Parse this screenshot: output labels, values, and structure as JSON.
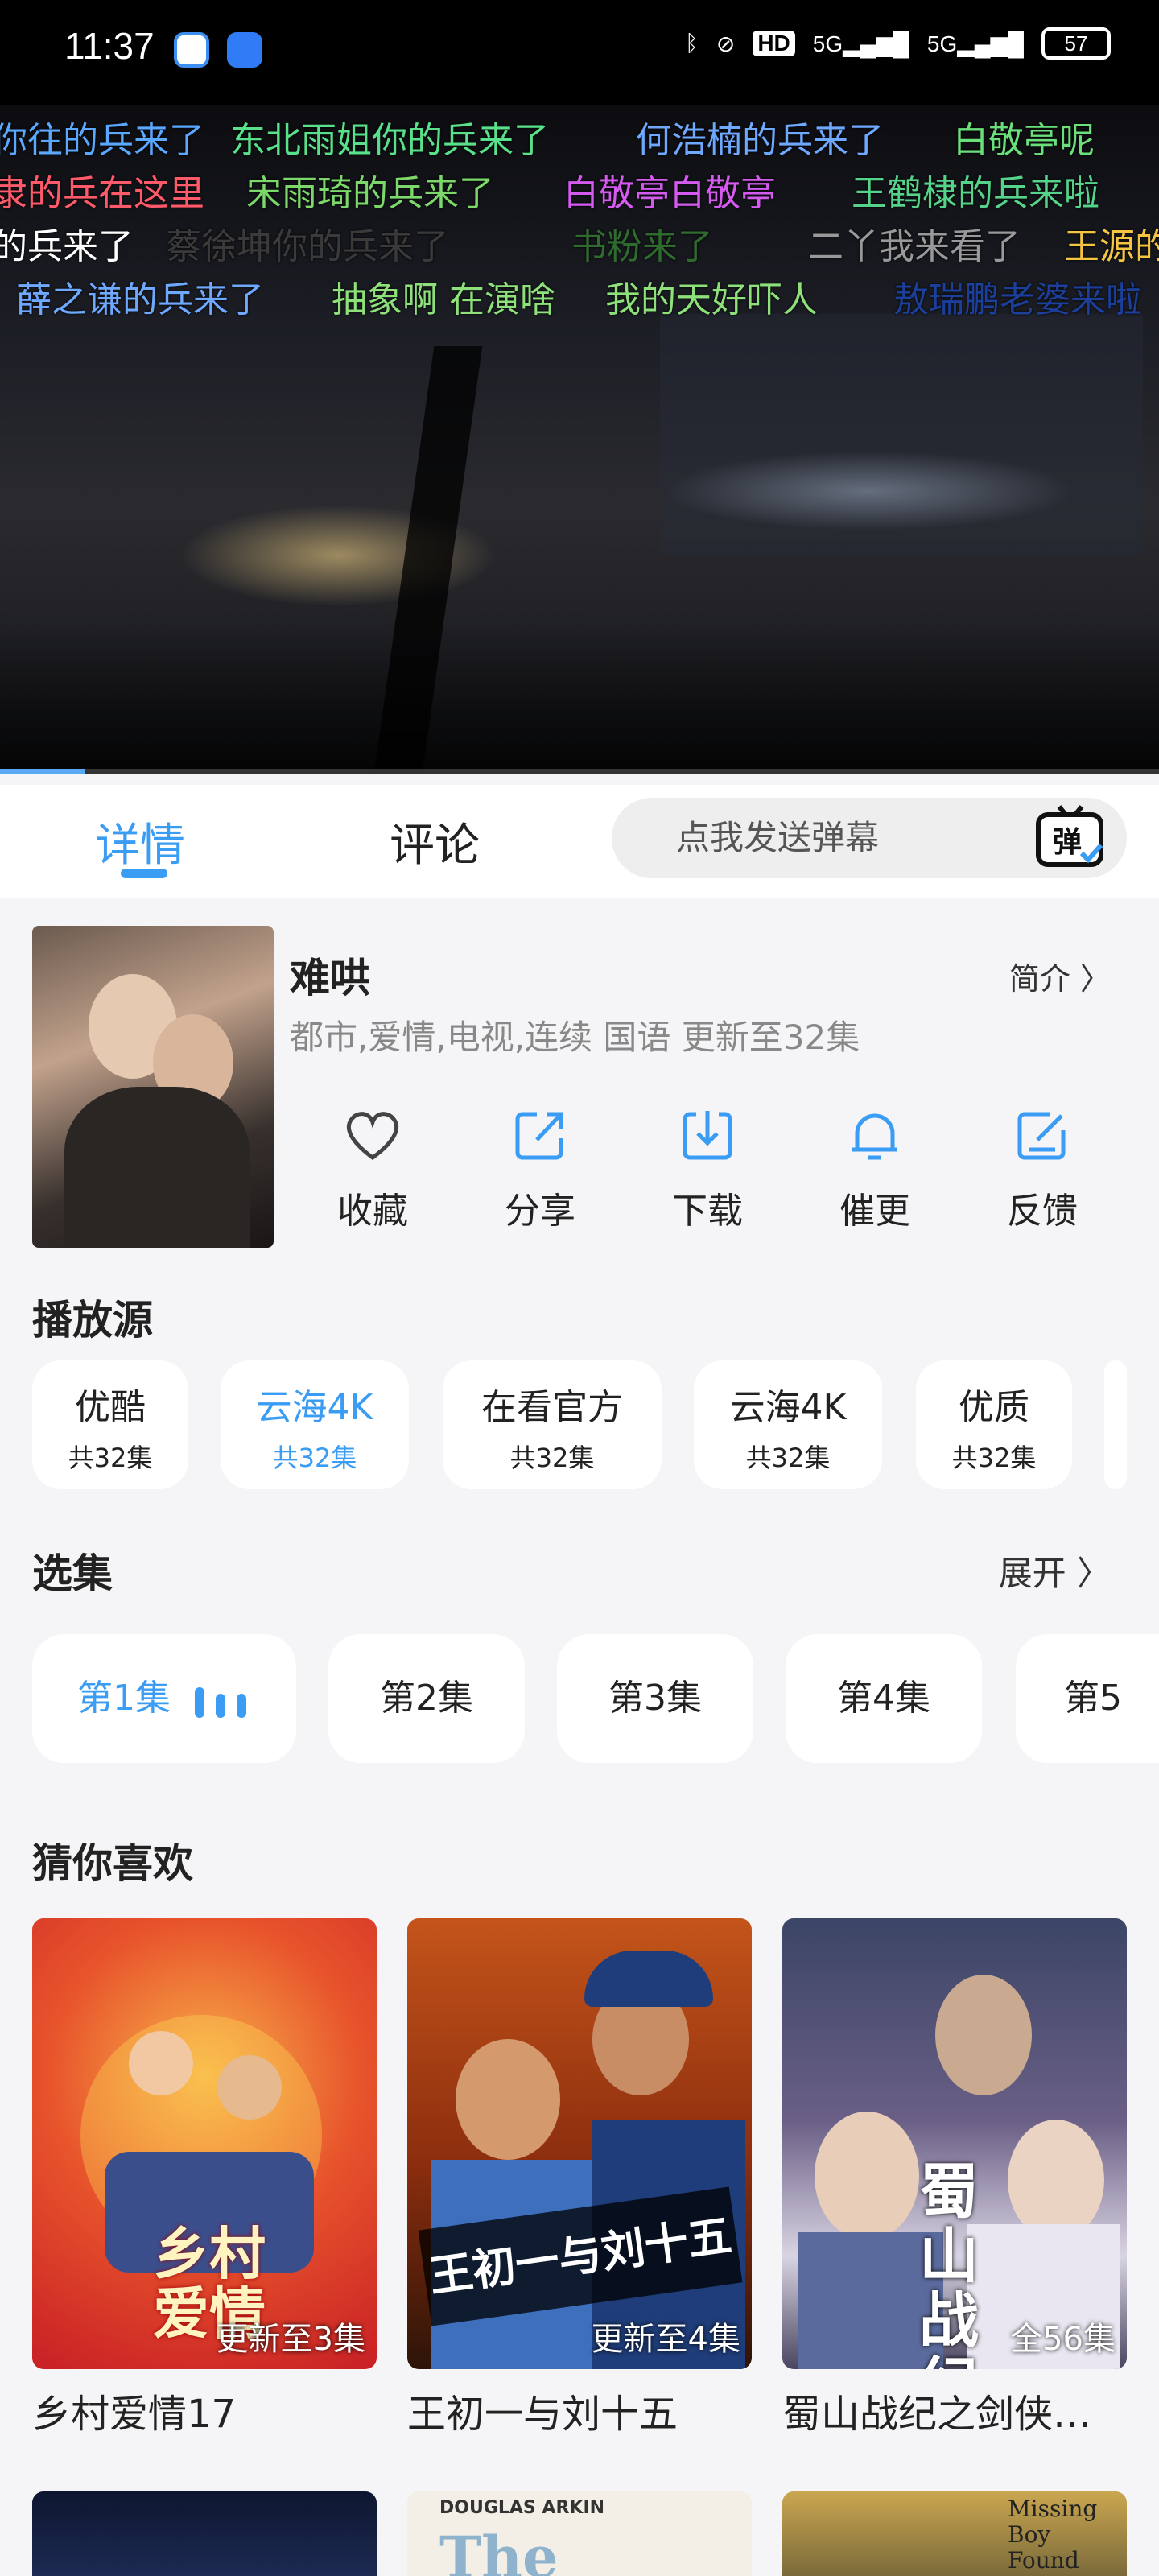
{
  "status_bar": {
    "time": "11:37",
    "battery": "57",
    "network": [
      "HD",
      "5G",
      "5G"
    ]
  },
  "danmaku": [
    {
      "text": "你往的兵来了",
      "color": "#5aa8ff"
    },
    {
      "text": "东北雨姐你的兵来了",
      "color": "#58e08a"
    },
    {
      "text": "何浩楠的兵来了",
      "color": "#6fa8ff"
    },
    {
      "text": "白敬亭呢",
      "color": "#6ae07a"
    },
    {
      "text": "隶的兵在这里",
      "color": "#ff5a6a"
    },
    {
      "text": "宋雨琦的兵来了",
      "color": "#7cd86a"
    },
    {
      "text": "白敬亭白敬亭",
      "color": "#d45af0"
    },
    {
      "text": "王鹤棣的兵来啦",
      "color": "#56d38a"
    },
    {
      "text": "的兵来了",
      "color": "#ffffff"
    },
    {
      "text": "蔡徐坤你的兵来了",
      "color": "#3a3a3a"
    },
    {
      "text": "书粉来了",
      "color": "#2f6a2f"
    },
    {
      "text": "二丫我来看了",
      "color": "#999999"
    },
    {
      "text": "王源的",
      "color": "#f5c542"
    },
    {
      "text": "薛之谦的兵来了",
      "color": "#6fa8ff"
    },
    {
      "text": "抽象啊 在演啥",
      "color": "#8ee07a"
    },
    {
      "text": "我的天好吓人",
      "color": "#8ee07a"
    },
    {
      "text": "敖瑞鹏老婆来啦",
      "color": "#1b3f9a"
    }
  ],
  "playback": {
    "progress_fraction": 0.073
  },
  "tabs": {
    "details": "详情",
    "comments": "评论",
    "danmu_placeholder": "点我发送弹幕",
    "danmu_icon_label": "弹"
  },
  "show": {
    "title": "难哄",
    "intro": "简介",
    "meta": "都市,爱情,电视,连续 国语 更新至32集"
  },
  "actions": [
    {
      "label": "收藏",
      "icon": "heart-icon"
    },
    {
      "label": "分享",
      "icon": "share-icon"
    },
    {
      "label": "下载",
      "icon": "download-icon"
    },
    {
      "label": "催更",
      "icon": "bell-icon"
    },
    {
      "label": "反馈",
      "icon": "feedback-icon"
    }
  ],
  "sources": {
    "title": "播放源",
    "items": [
      {
        "name": "优酷",
        "count": "共32集"
      },
      {
        "name": "云海4K",
        "count": "共32集",
        "active": true
      },
      {
        "name": "在看官方",
        "count": "共32集"
      },
      {
        "name": "云海4K",
        "count": "共32集"
      },
      {
        "name": "优质",
        "count": "共32集"
      }
    ]
  },
  "episodes": {
    "title": "选集",
    "expand": "展开",
    "items": [
      "第1集",
      "第2集",
      "第3集",
      "第4集",
      "第5"
    ]
  },
  "recommend": {
    "title": "猜你喜欢",
    "items": [
      {
        "name": "乡村爱情17",
        "badge": "更新至3集"
      },
      {
        "name": "王初一与刘十五",
        "badge": "更新至4集"
      },
      {
        "name": "蜀山战纪之剑侠…",
        "badge": "全56集"
      }
    ]
  },
  "poster_text": {
    "card1": "乡村爱情",
    "card2": "王初一与刘十五",
    "card3": "蜀山战纪",
    "card5a": "DOUGLAS ARKIN",
    "card5b": "The",
    "card6": "Missing Boy Found"
  }
}
